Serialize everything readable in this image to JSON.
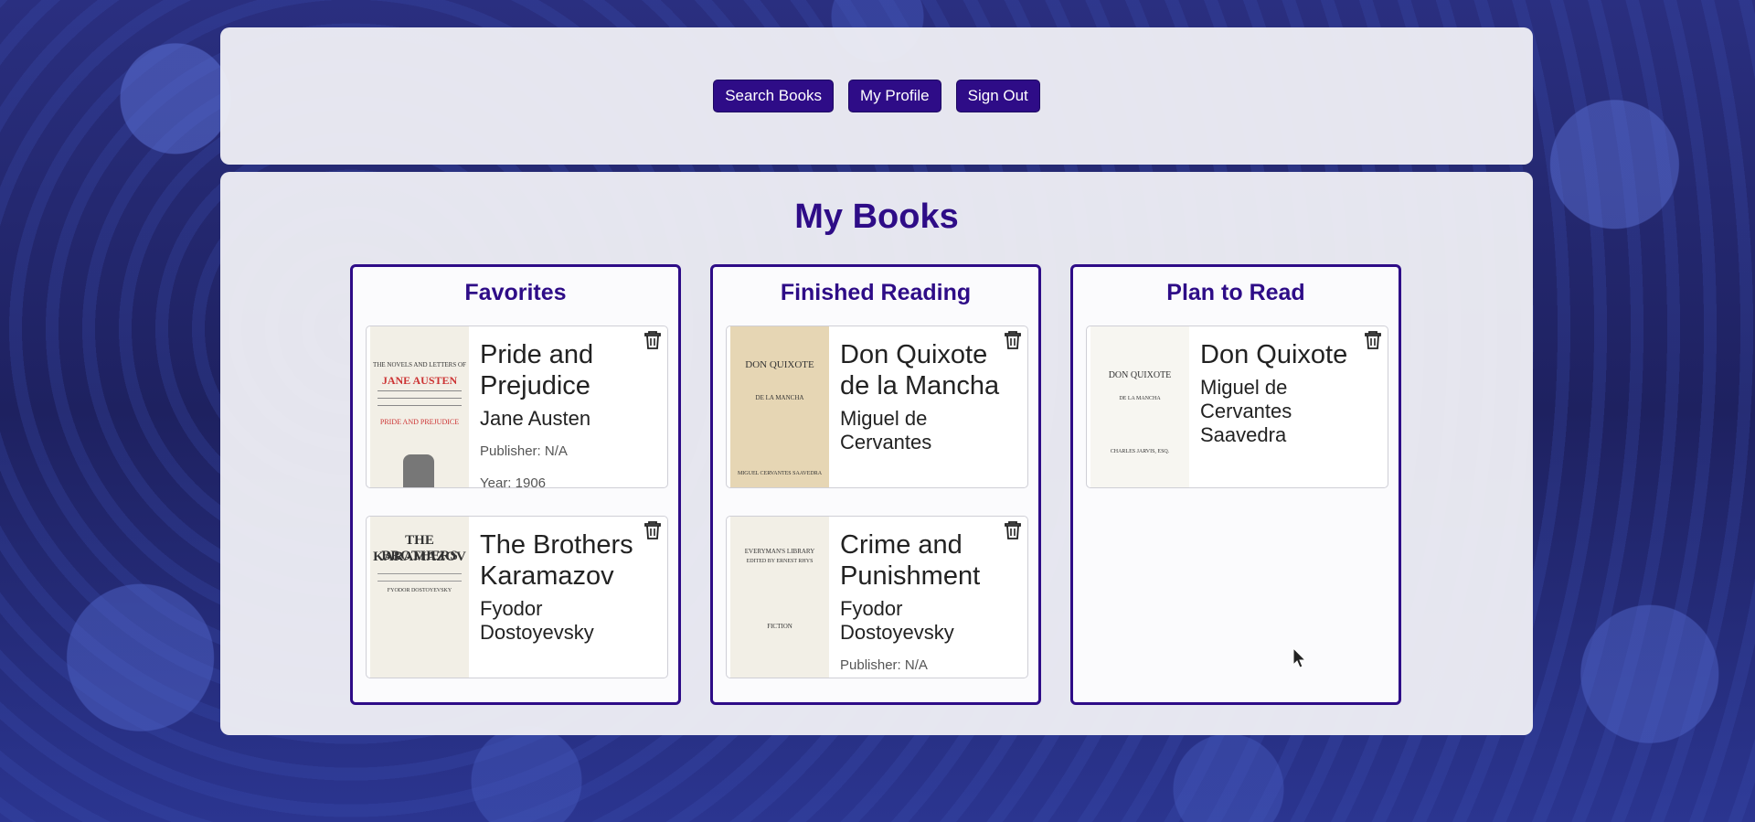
{
  "nav": {
    "buttons": [
      "Search Books",
      "My Profile",
      "Sign Out"
    ]
  },
  "page_title": "My Books",
  "lists": [
    {
      "title": "Favorites",
      "books": [
        {
          "title": "Pride and Prejudice",
          "author": "Jane Austen",
          "publisher": "Publisher: N/A",
          "year": "Year: 1906",
          "cover_text": [
            "THE NOVELS AND LETTERS OF",
            "JANE AUSTEN",
            "PRIDE AND PREJUDICE"
          ]
        },
        {
          "title": "The Brothers Karamazov",
          "author": "Fyodor Dostoyevsky",
          "cover_text": [
            "THE BROTHERS",
            "KARAMAZOV",
            "FYODOR DOSTOYEVSKY"
          ]
        }
      ]
    },
    {
      "title": "Finished Reading",
      "books": [
        {
          "title": "Don Quixote de la Mancha",
          "author": "Miguel de Cervantes",
          "cover_text": [
            "DON QUIXOTE",
            "DE LA MANCHA",
            "MIGUEL CERVANTES SAAVEDRA"
          ]
        },
        {
          "title": "Crime and Punishment",
          "author": "Fyodor Dostoyevsky",
          "publisher": "Publisher: N/A",
          "cover_text": [
            "EVERYMAN'S LIBRARY",
            "EDITED BY ERNEST RHYS",
            "FICTION"
          ]
        }
      ]
    },
    {
      "title": "Plan to Read",
      "books": [
        {
          "title": "Don Quixote",
          "author": "Miguel de Cervantes Saavedra",
          "cover_text": [
            "DON QUIXOTE",
            "DE LA MANCHA",
            "CHARLES JARVIS, ESQ."
          ]
        }
      ]
    }
  ],
  "colors": {
    "accent": "#2e0c87",
    "panel": "#f0f0f6"
  }
}
